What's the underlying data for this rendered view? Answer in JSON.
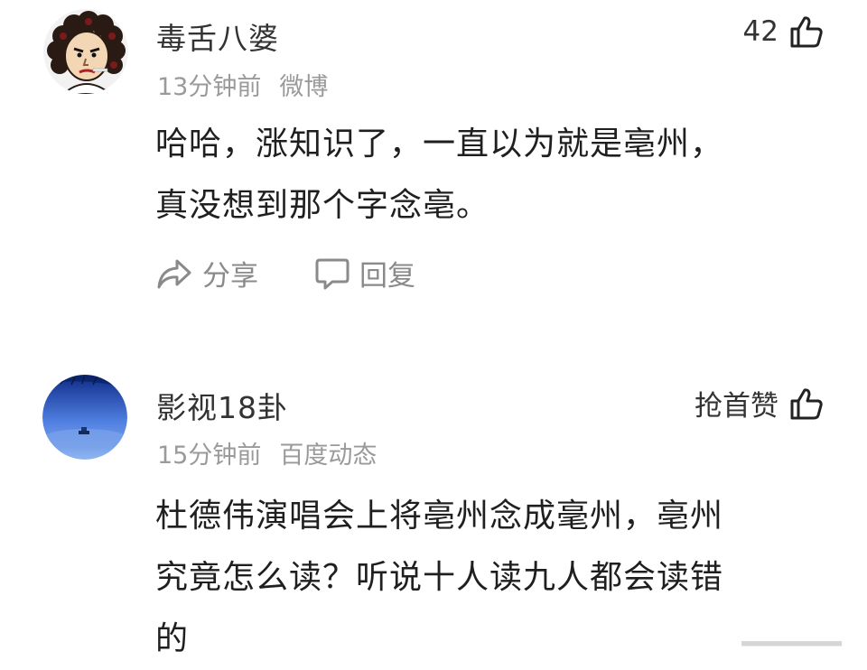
{
  "comments": [
    {
      "username": "毒舌八婆",
      "time": "13分钟前",
      "source": "微博",
      "likes": "42",
      "content_lines": [
        "哈哈，涨知识了，一直以为就是亳州，",
        "真没想到那个字念亳。"
      ],
      "actions": {
        "share": "分享",
        "reply": "回复"
      },
      "avatar_icon": "cartoon-face-avatar"
    },
    {
      "username": "影视18卦",
      "time": "15分钟前",
      "source": "百度动态",
      "likes": "抢首赞",
      "content_lines": [
        "杜德伟演唱会上将亳州念成毫州，亳州",
        "究竟怎么读？听说十人读九人都会读错",
        "的"
      ],
      "avatar_icon": "beach-sky-avatar"
    }
  ],
  "colors": {
    "text_primary": "#1f1f1f",
    "text_secondary": "#9a9a9a",
    "action_gray": "#8a8a8a"
  }
}
